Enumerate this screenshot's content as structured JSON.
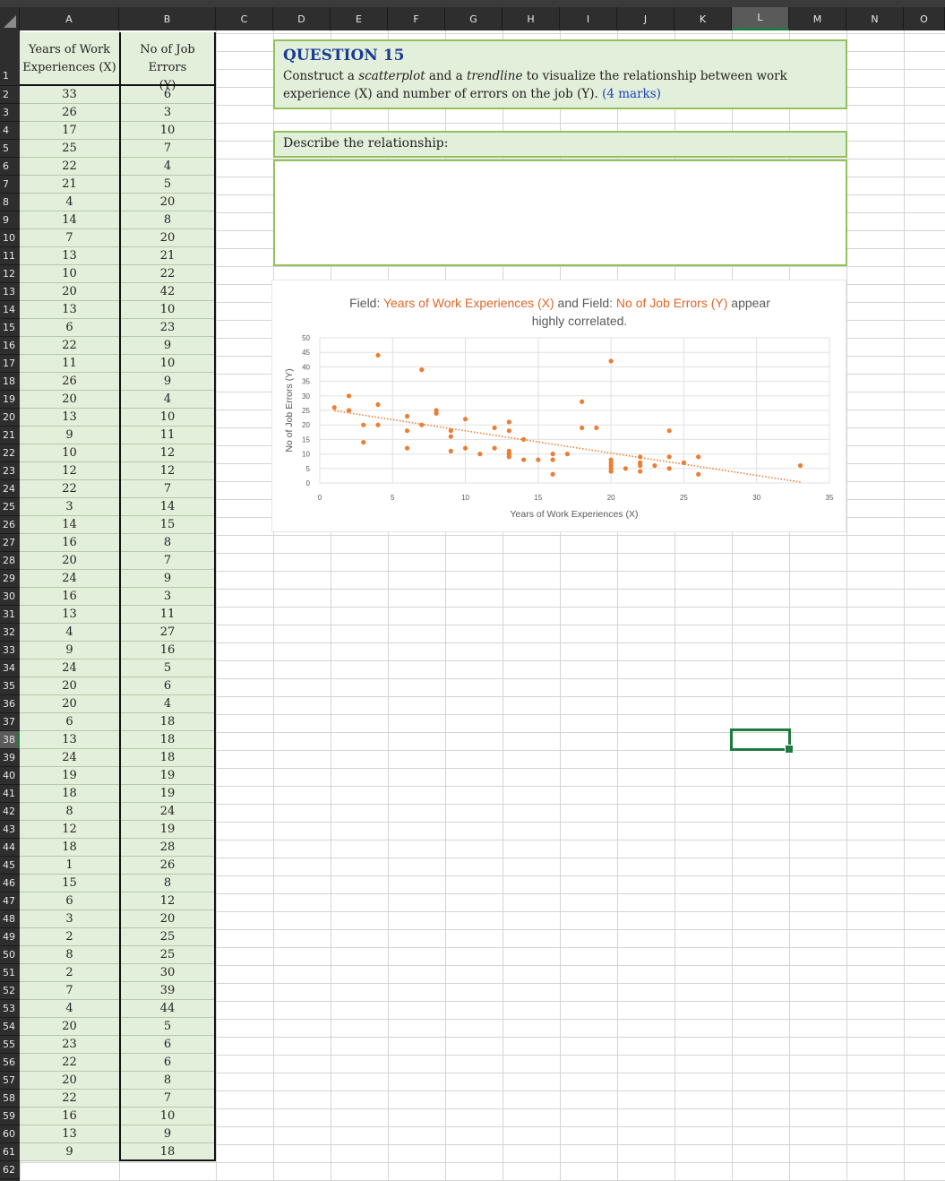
{
  "columns": [
    "A",
    "B",
    "C",
    "D",
    "E",
    "F",
    "G",
    "H",
    "I",
    "J",
    "K",
    "L",
    "M",
    "N",
    "O"
  ],
  "active_column": "L",
  "active_row": "38",
  "rows": [
    "1",
    "2",
    "3",
    "4",
    "5",
    "6",
    "7",
    "8",
    "9",
    "10",
    "11",
    "12",
    "13",
    "14",
    "15",
    "16",
    "17",
    "18",
    "19",
    "20",
    "21",
    "22",
    "23",
    "24",
    "25",
    "26",
    "27",
    "28",
    "29",
    "30",
    "31",
    "32",
    "33",
    "34",
    "35",
    "36",
    "37",
    "38",
    "39",
    "40",
    "41",
    "42",
    "43",
    "44",
    "45",
    "46",
    "47",
    "48",
    "49",
    "50",
    "51",
    "52",
    "53",
    "54",
    "55",
    "56",
    "57",
    "58",
    "59",
    "60",
    "61",
    "62"
  ],
  "table": {
    "header_x_line1": "Years of Work",
    "header_x_line2": "Experiences (X)",
    "header_y_line1": "No of Job Errors",
    "header_y_line2": "(Y)",
    "x_values": [
      33,
      26,
      17,
      25,
      22,
      21,
      4,
      14,
      7,
      13,
      10,
      20,
      13,
      6,
      22,
      11,
      26,
      20,
      13,
      9,
      10,
      12,
      22,
      3,
      14,
      16,
      20,
      24,
      16,
      13,
      4,
      9,
      24,
      20,
      20,
      6,
      13,
      24,
      19,
      18,
      8,
      12,
      18,
      1,
      15,
      6,
      3,
      2,
      8,
      2,
      7,
      4,
      20,
      23,
      22,
      20,
      22,
      16,
      13,
      9
    ],
    "y_values": [
      6,
      3,
      10,
      7,
      4,
      5,
      20,
      8,
      20,
      21,
      22,
      42,
      10,
      23,
      9,
      10,
      9,
      4,
      10,
      11,
      12,
      12,
      7,
      14,
      15,
      8,
      7,
      9,
      3,
      11,
      27,
      16,
      5,
      6,
      4,
      18,
      18,
      18,
      19,
      19,
      24,
      19,
      28,
      26,
      8,
      12,
      20,
      25,
      25,
      30,
      39,
      44,
      5,
      6,
      6,
      8,
      7,
      10,
      9,
      18
    ]
  },
  "question": {
    "title": "QUESTION 15",
    "text_part1": "Construct a ",
    "text_em1": "scatterplot",
    "text_part2": " and a ",
    "text_em2": "trendline",
    "text_part3": " to visualize the relationship between work experience (X) and number of errors on the job (Y). ",
    "marks": "(4 marks)"
  },
  "describe_label": "Describe the relationship:",
  "answer_text": "",
  "chart_data": {
    "type": "scatter",
    "title_prefix": "Field: ",
    "title_field_x": "Years of Work Experiences (X)",
    "title_mid": " and Field: ",
    "title_field_y": "No of Job Errors  (Y)",
    "title_suffix": " appear highly correlated.",
    "xlabel": "Years of Work Experiences (X)",
    "ylabel": "No of Job Errors  (Y)",
    "xlim": [
      0,
      35
    ],
    "ylim": [
      0,
      50
    ],
    "x_ticks": [
      0,
      5,
      10,
      15,
      20,
      25,
      30,
      35
    ],
    "y_ticks": [
      0,
      5,
      10,
      15,
      20,
      25,
      30,
      35,
      40,
      45,
      50
    ],
    "grid": true,
    "trendline": "linear, dotted",
    "marker_color": "#ed7d31",
    "title_color": "#595959",
    "field_color": "#e0662a",
    "x": [
      33,
      26,
      17,
      25,
      22,
      21,
      4,
      14,
      7,
      13,
      10,
      20,
      13,
      6,
      22,
      11,
      26,
      20,
      13,
      9,
      10,
      12,
      22,
      3,
      14,
      16,
      20,
      24,
      16,
      13,
      4,
      9,
      24,
      20,
      20,
      6,
      13,
      24,
      19,
      18,
      8,
      12,
      18,
      1,
      15,
      6,
      3,
      2,
      8,
      2,
      7,
      4,
      20,
      23,
      22,
      20,
      22,
      16,
      13,
      9
    ],
    "y": [
      6,
      3,
      10,
      7,
      4,
      5,
      20,
      8,
      20,
      21,
      22,
      42,
      10,
      23,
      9,
      10,
      9,
      4,
      10,
      11,
      12,
      12,
      7,
      14,
      15,
      8,
      7,
      9,
      3,
      11,
      27,
      16,
      5,
      6,
      4,
      18,
      18,
      18,
      19,
      19,
      24,
      19,
      28,
      26,
      8,
      12,
      20,
      25,
      25,
      30,
      39,
      44,
      5,
      6,
      6,
      8,
      7,
      10,
      9,
      18
    ]
  },
  "colors": {
    "table_fill": "#e2efda",
    "box_border": "#92c05a",
    "question_title": "#1b3a94",
    "marks": "#2040c0",
    "selection": "#1f7a3f"
  }
}
